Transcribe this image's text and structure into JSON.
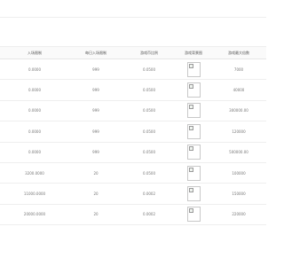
{
  "table": {
    "columns": [
      "入场限制",
      "每日入场限制",
      "游戏币比例",
      "游戏背景图",
      "游戏最大倍数"
    ],
    "rows": [
      {
        "limit": "0.0000",
        "daily": "999",
        "ratio": "0.0500",
        "multiplier": "7000"
      },
      {
        "limit": "0.0000",
        "daily": "999",
        "ratio": "0.0500",
        "multiplier": "40000"
      },
      {
        "limit": "0.0000",
        "daily": "999",
        "ratio": "0.0500",
        "multiplier": "300000.00"
      },
      {
        "limit": "0.0000",
        "daily": "999",
        "ratio": "0.0500",
        "multiplier": "120000"
      },
      {
        "limit": "0.0000",
        "daily": "999",
        "ratio": "0.0500",
        "multiplier": "500000.00"
      },
      {
        "limit": "3200.0000",
        "daily": "20",
        "ratio": "0.0500",
        "multiplier": "100000"
      },
      {
        "limit": "11000.0000",
        "daily": "20",
        "ratio": "0.0002",
        "multiplier": "150000"
      },
      {
        "limit": "20000.0000",
        "daily": "20",
        "ratio": "0.0002",
        "multiplier": "220000"
      }
    ]
  }
}
